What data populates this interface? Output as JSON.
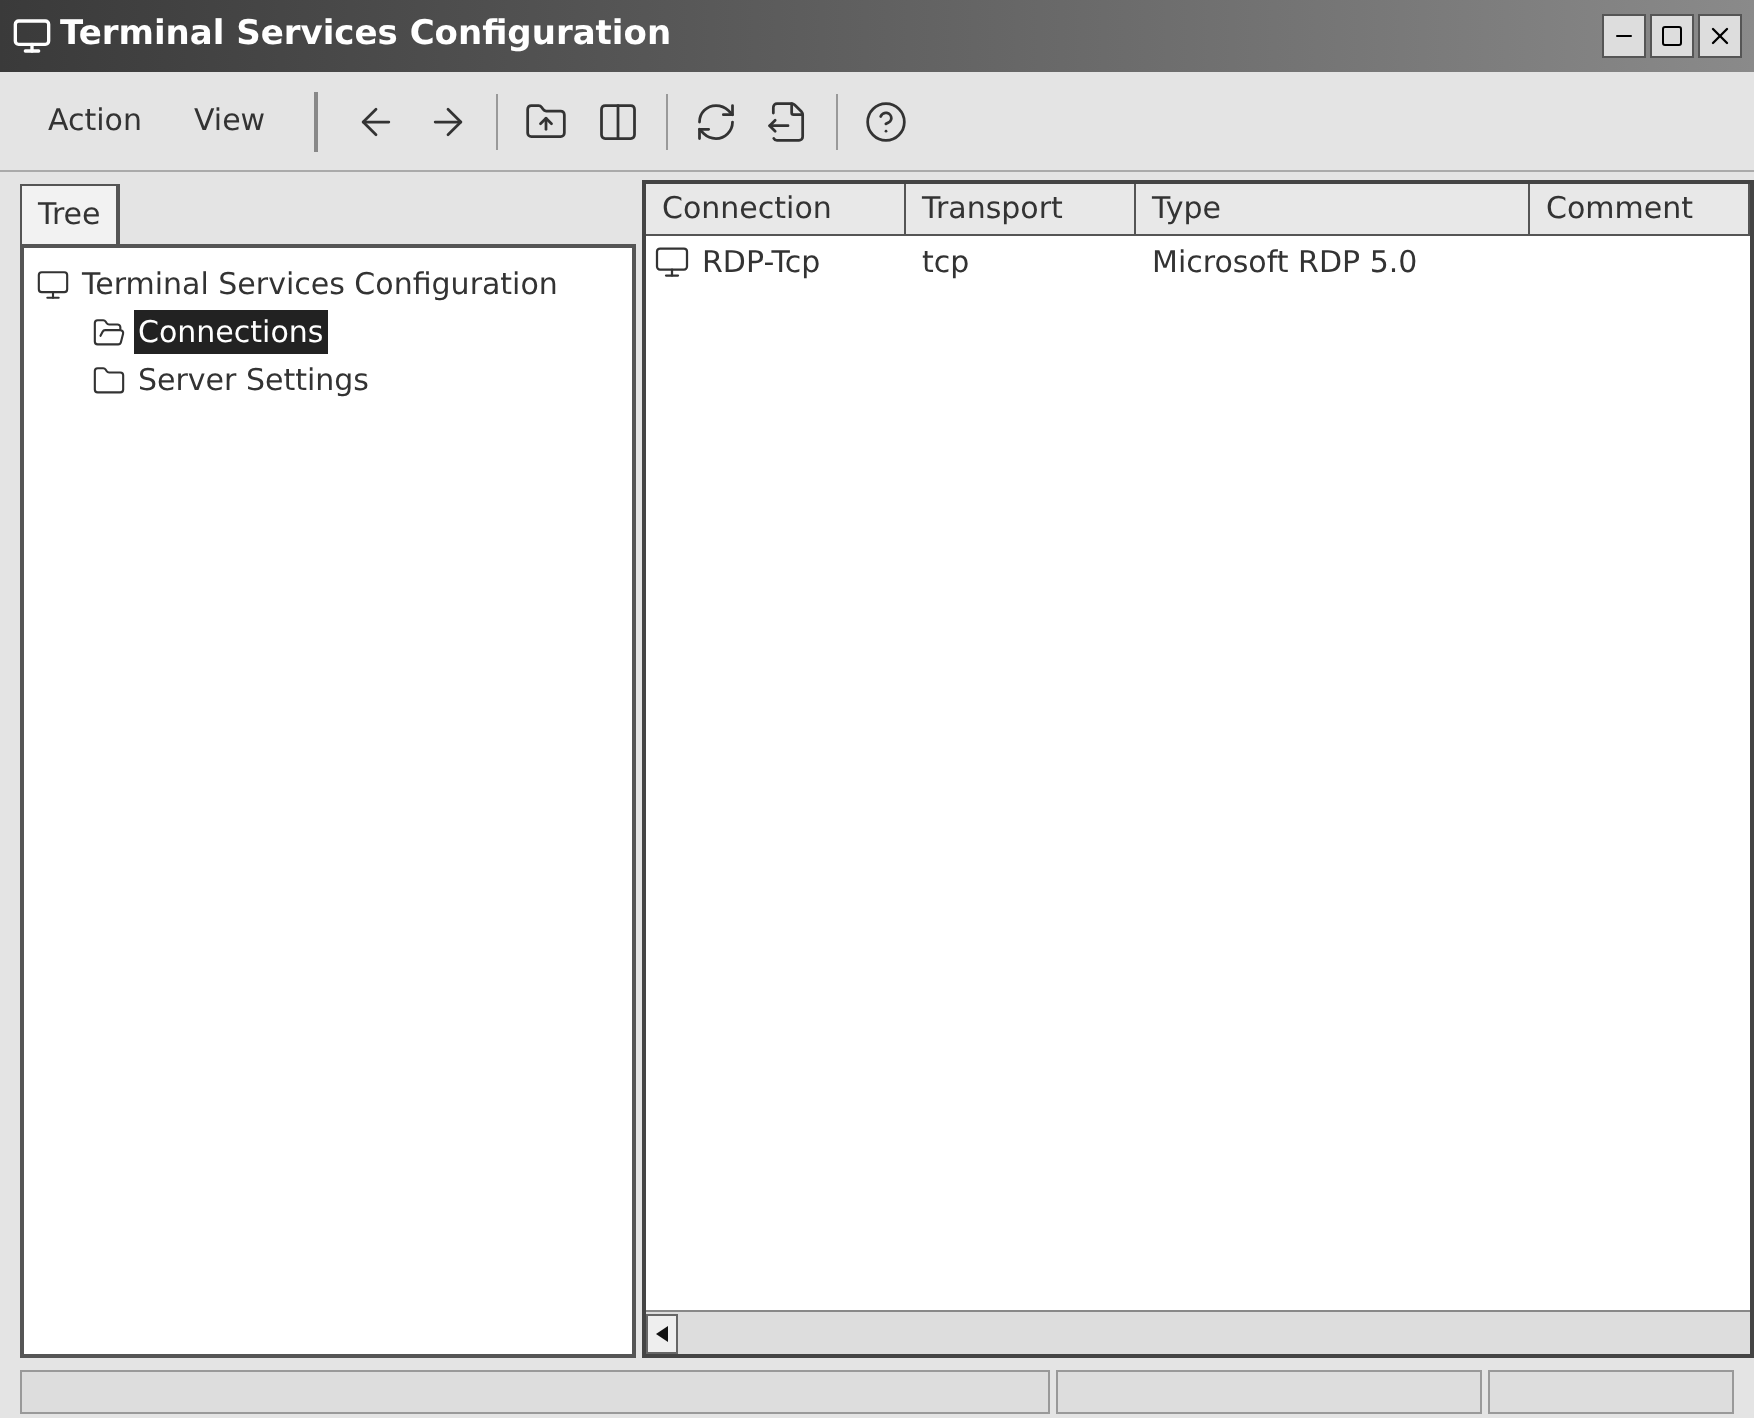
{
  "window": {
    "title": "Terminal Services Configuration"
  },
  "menu": [
    {
      "label": "Action"
    },
    {
      "label": "View"
    }
  ],
  "tree_tab": {
    "label": "Tree",
    "selected": true
  },
  "tree": [
    {
      "label": "Terminal Services Configuration",
      "kind": "root",
      "selected": false,
      "children": [
        {
          "label": "Connections",
          "kind": "folder",
          "selected": true
        },
        {
          "label": "Server Settings",
          "kind": "folder",
          "selected": false
        }
      ]
    }
  ],
  "table": {
    "columns": [
      "Connection",
      "Transport",
      "Type",
      "Comment"
    ],
    "rows": [
      {
        "cells": [
          "RDP-Tcp",
          "tcp",
          "Microsoft RDP 5.0"
        ]
      }
    ]
  }
}
